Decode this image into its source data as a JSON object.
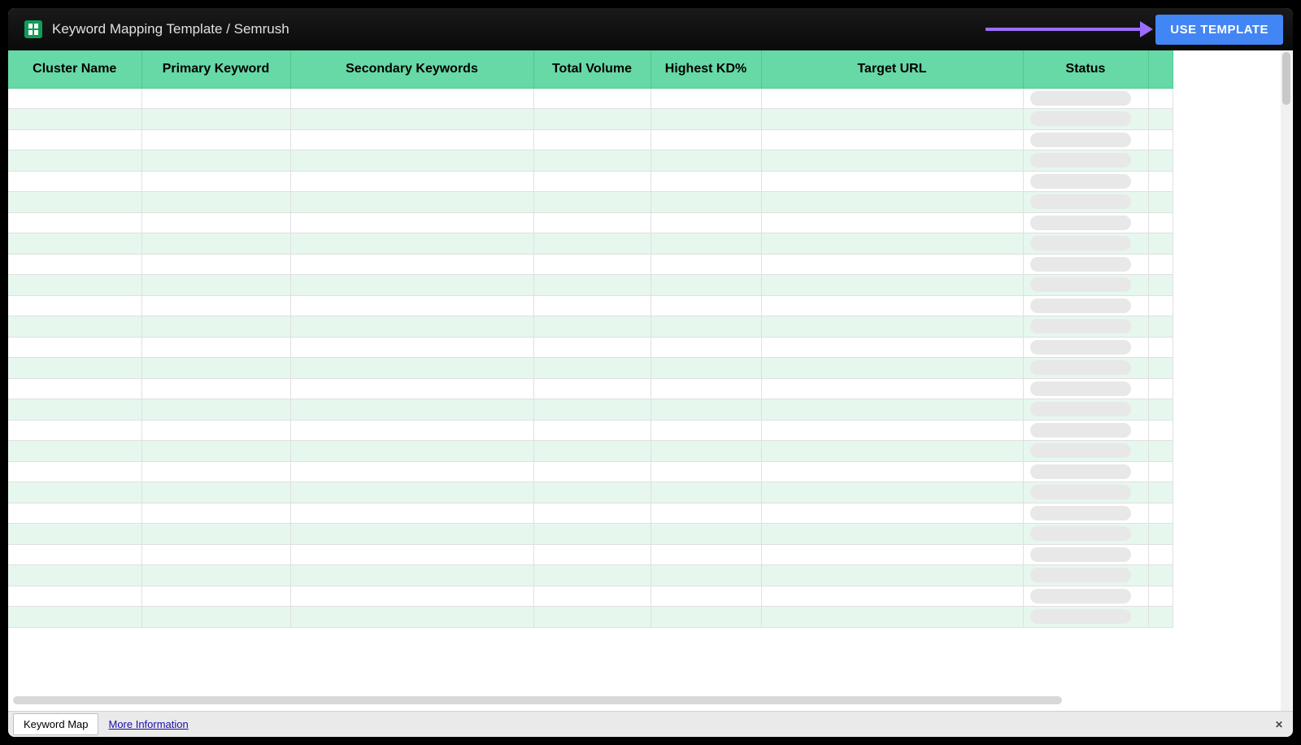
{
  "titlebar": {
    "document_title": "Keyword Mapping Template / Semrush",
    "use_template_label": "USE TEMPLATE"
  },
  "columns": [
    {
      "key": "cluster",
      "label": "Cluster Name",
      "class": "col-cluster"
    },
    {
      "key": "primary",
      "label": "Primary Keyword",
      "class": "col-primary"
    },
    {
      "key": "secondary",
      "label": "Secondary Keywords",
      "class": "col-secondary"
    },
    {
      "key": "volume",
      "label": "Total Volume",
      "class": "col-volume"
    },
    {
      "key": "kd",
      "label": "Highest KD%",
      "class": "col-kd"
    },
    {
      "key": "url",
      "label": "Target URL",
      "class": "col-url"
    },
    {
      "key": "status",
      "label": "Status",
      "class": "col-status"
    },
    {
      "key": "extra",
      "label": "",
      "class": "col-extra"
    }
  ],
  "row_count": 26,
  "tabs": {
    "active_tab_label": "Keyword Map",
    "more_info_label": "More Information",
    "close_glyph": "✕"
  }
}
